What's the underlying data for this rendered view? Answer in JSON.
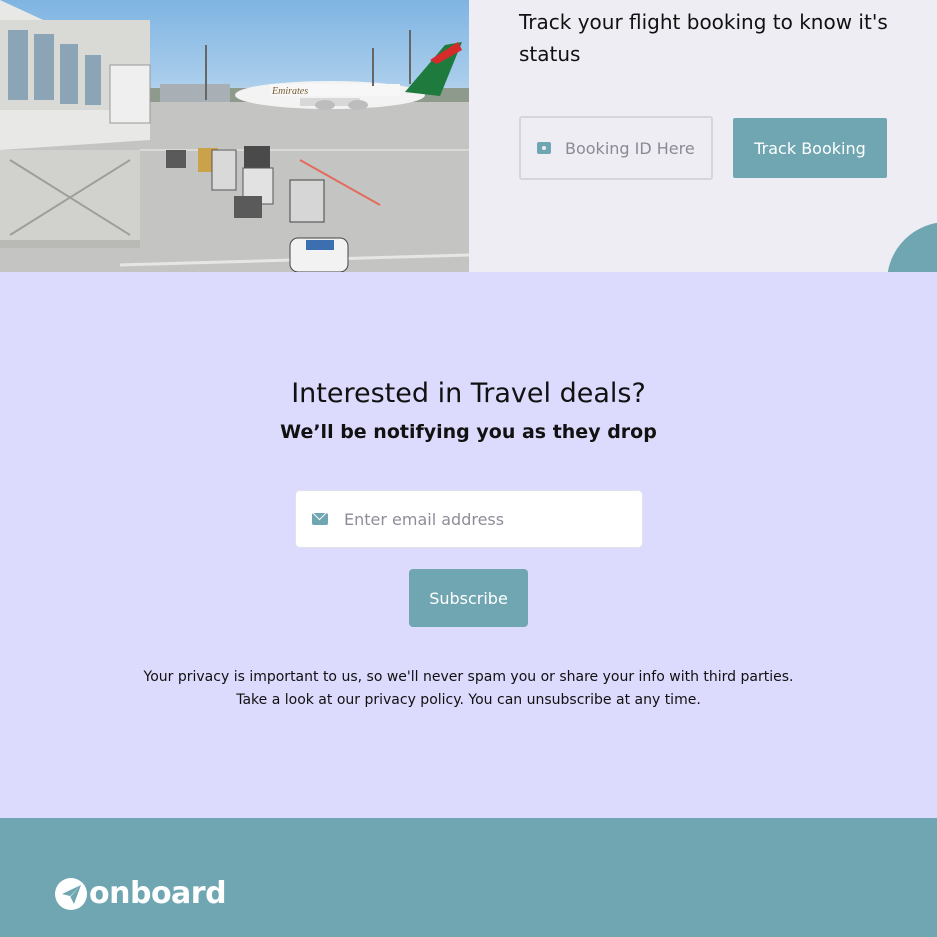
{
  "tracking": {
    "title": "Track your flight booking to know it's status",
    "booking_input": {
      "placeholder": "Booking ID Here",
      "icon": "ticket-icon"
    },
    "track_button_label": "Track Booking"
  },
  "newsletter": {
    "title": "Interested in Travel deals?",
    "subtitle": "We’ll be notifying you as they drop",
    "email_input": {
      "placeholder": "Enter email address",
      "icon": "mail-icon"
    },
    "subscribe_label": "Subscribe",
    "privacy_lines": [
      "Your privacy is important to us, so we'll never spam you or share your info with third parties.",
      "Take a look at our privacy policy. You can unsubscribe at any time."
    ]
  },
  "footer": {
    "logo_text": "onboard",
    "logo_icon": "paper-plane-icon"
  },
  "photo": {
    "airline_text": "Emirates"
  },
  "colors": {
    "accent": "#6FA6B2",
    "track_bg": "#EEEDF3",
    "newsletter_bg": "#DCDAFD",
    "text": "#111111"
  }
}
